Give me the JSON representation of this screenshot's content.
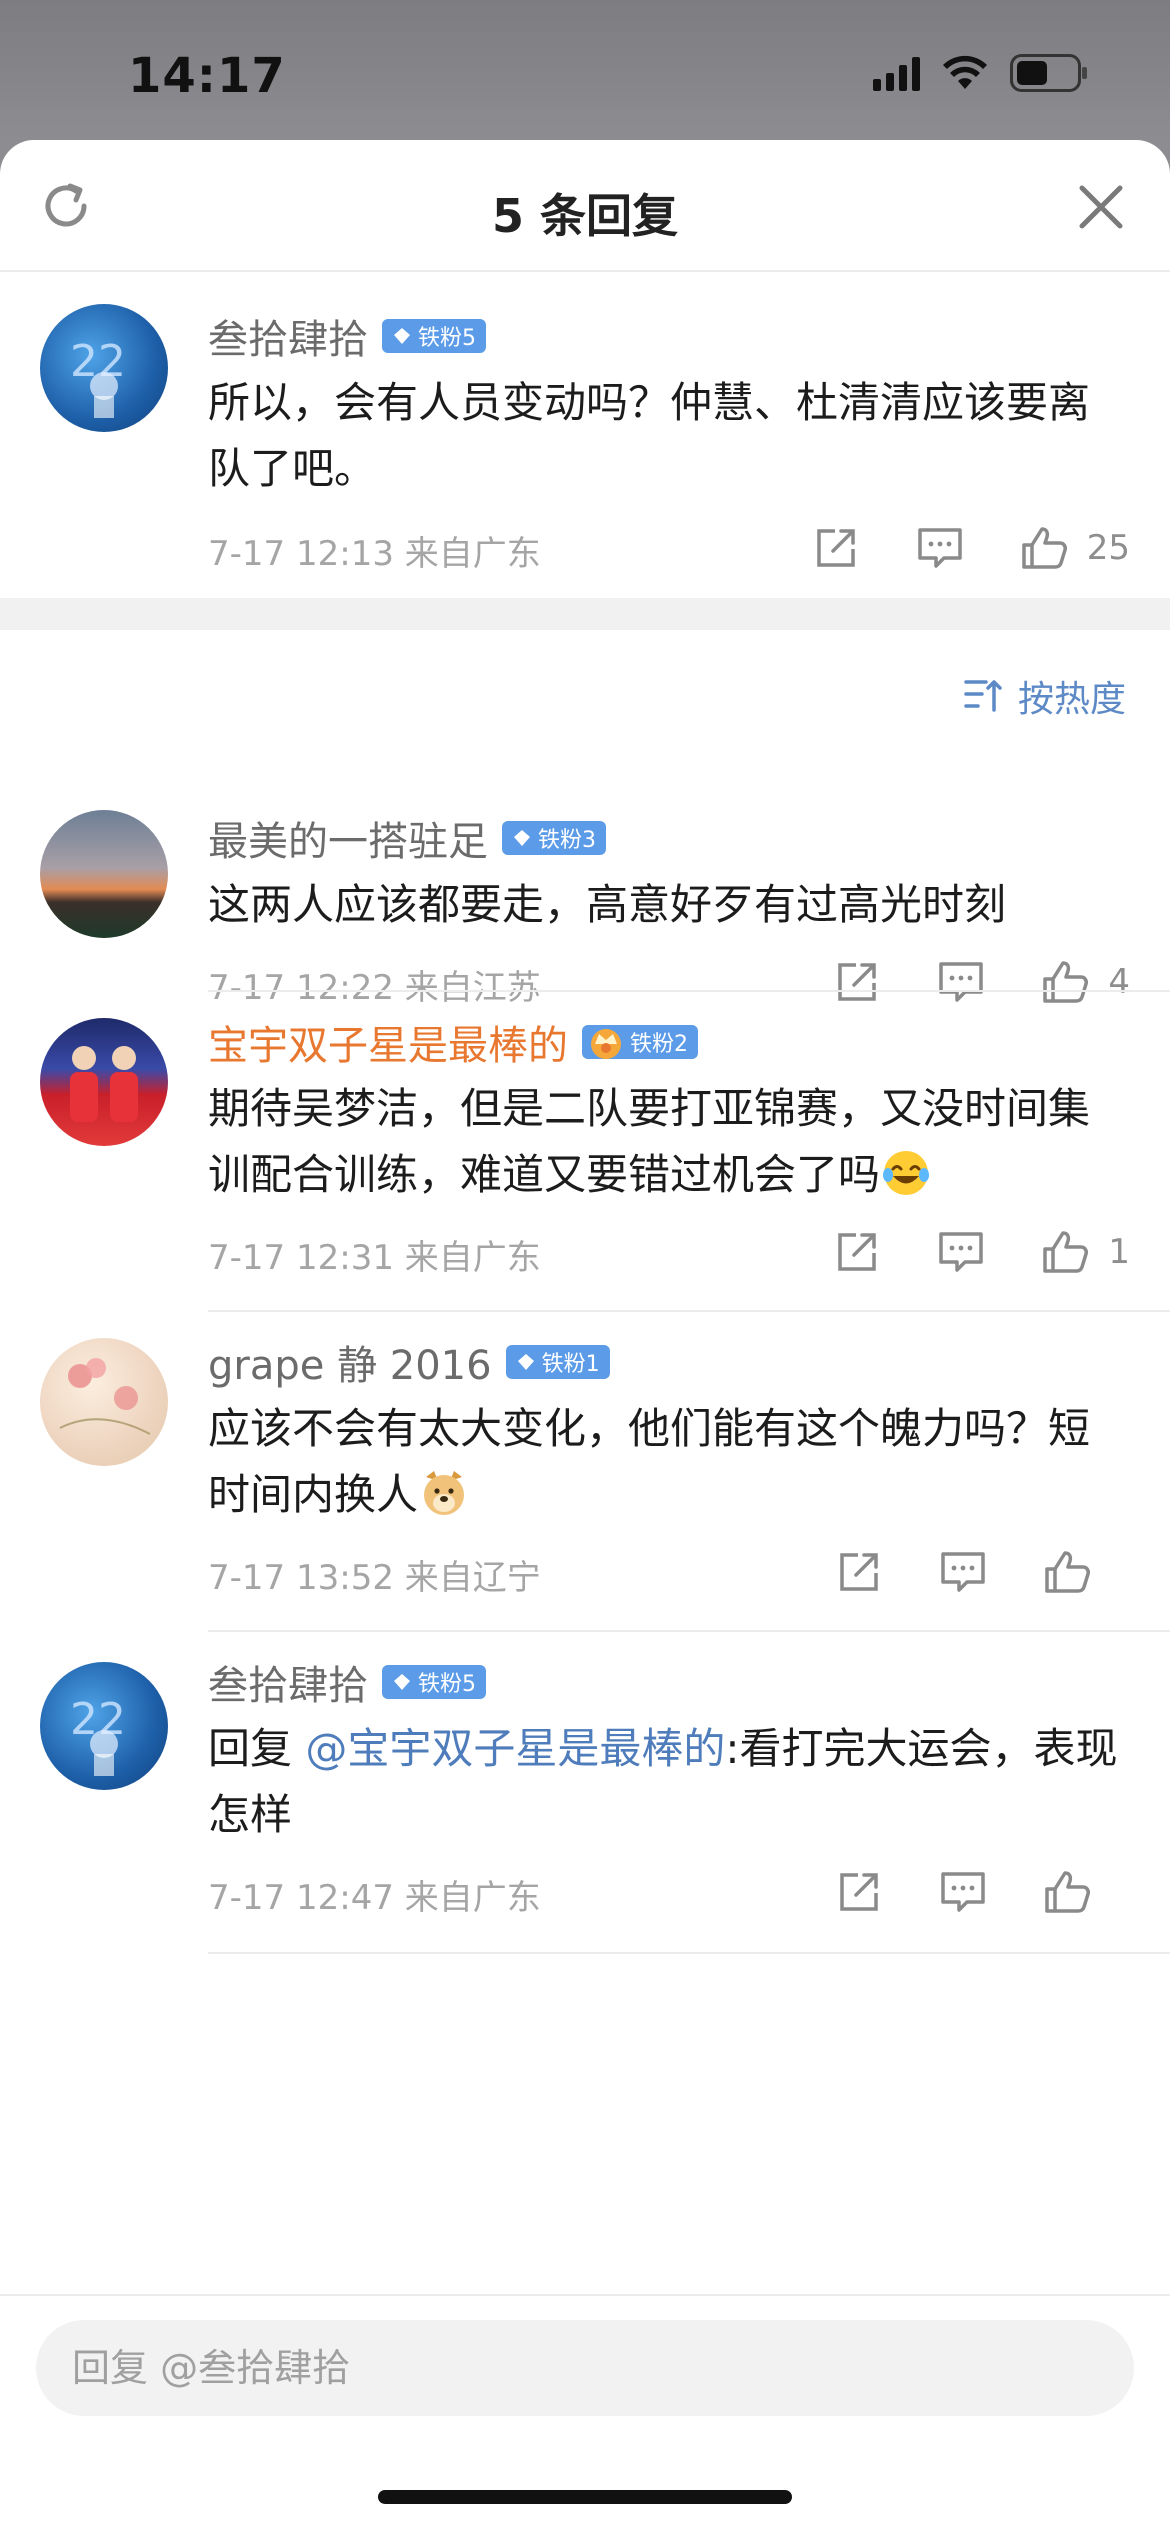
{
  "status_bar": {
    "time": "14:17"
  },
  "sheet": {
    "title": "5 条回复",
    "sort_label": "按热度"
  },
  "main_comment": {
    "username": "叁拾肆拾",
    "badge": "铁粉5",
    "text": "所以，会有人员变动吗？仲慧、杜清清应该要离队了吧。",
    "meta": "7-17 12:13  来自广东",
    "likes": "25"
  },
  "replies": [
    {
      "username": "最美的一搭驻足",
      "badge": "铁粉3",
      "text": "这两人应该都要走，高意好歹有过高光时刻",
      "meta": "7-17 12:22  来自江苏",
      "likes": "4"
    },
    {
      "username": "宝宇双子星是最棒的",
      "badge": "铁粉2",
      "text": "期待吴梦洁，但是二队要打亚锦赛，又没时间集训配合训练，难道又要错过机会了吗",
      "meta": "7-17 12:31  来自广东",
      "likes": "1"
    },
    {
      "username": "grape 静 2016",
      "badge": "铁粉1",
      "text": "应该不会有太大变化，他们能有这个魄力吗？短时间内换人",
      "meta": "7-17 13:52  来自辽宁",
      "likes": ""
    },
    {
      "username": "叁拾肆拾",
      "badge": "铁粉5",
      "text_prefix": "回复 ",
      "mention": "@宝宇双子星是最棒的",
      "text": ":看打完大运会，表现怎样",
      "meta": "7-17 12:47  来自广东",
      "likes": ""
    }
  ],
  "reply_box": {
    "placeholder": "回复 @叁拾肆拾"
  },
  "icons": {
    "refresh": "refresh-icon",
    "close": "close-icon",
    "share": "share-icon",
    "comment": "comment-icon",
    "like": "thumbs-up-icon",
    "sort": "sort-icon"
  },
  "colors": {
    "accent_blue": "#5d8ac6",
    "badge_blue": "#5b9be8",
    "vip_orange": "#e8772f",
    "meta_gray": "#a5a5a5"
  }
}
